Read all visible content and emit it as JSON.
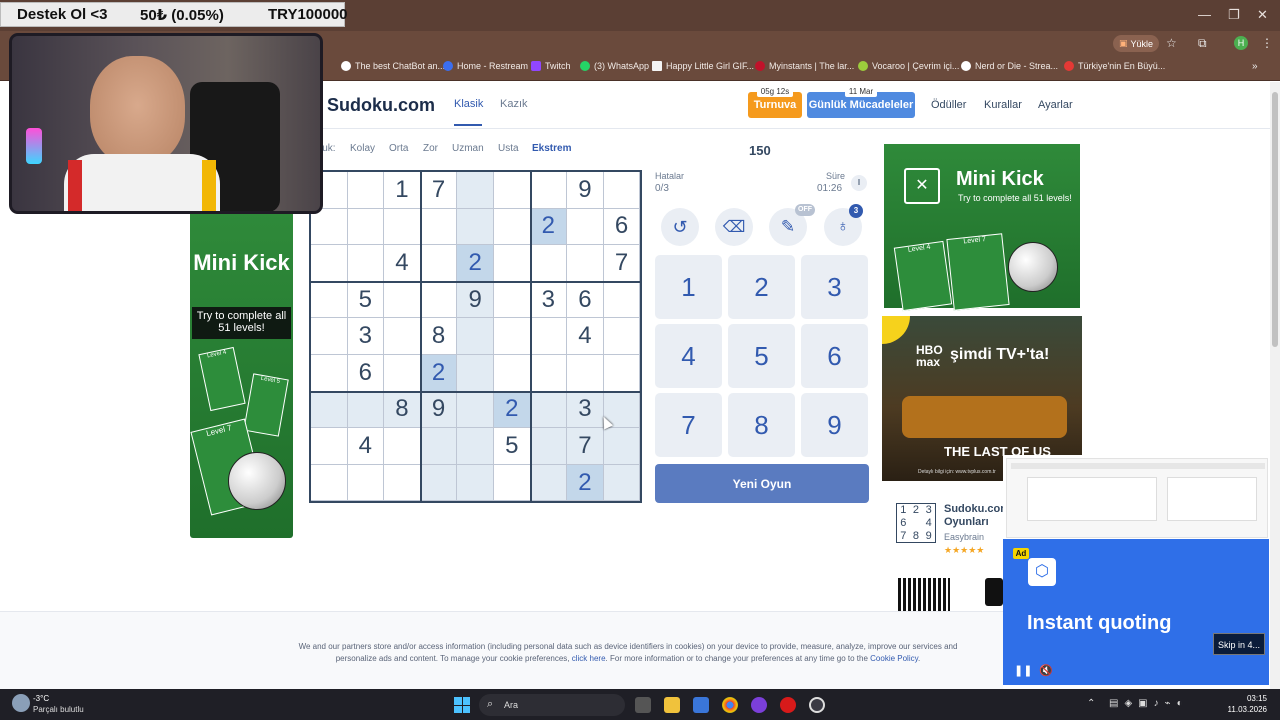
{
  "donation": {
    "left": "Destek Ol <3",
    "mid": "50₺ (0.05%)",
    "right": "TRY100000"
  },
  "browser": {
    "upload_label": "Yükle",
    "bookmarks": [
      "The best ChatBot an...",
      "Home - Restream",
      "Twitch",
      "(3) WhatsApp",
      "Happy Little Girl GIF...",
      "Myinstants | The lar...",
      "Vocaroo | Çevrim içi...",
      "Nerd or Die - Strea...",
      "Türkiye'nin En Büyü..."
    ]
  },
  "site": {
    "logo": "Sudoku.com",
    "tabs": [
      "Klasik",
      "Kazık"
    ],
    "streak_days": "05g 12s",
    "tournament": "Turnuva",
    "daily_date": "11 Mar",
    "daily": "Günlük Mücadeleler",
    "nav": [
      "Ödüller",
      "Kurallar",
      "Ayarlar"
    ],
    "difficulty_prefix": "luk:",
    "difficulties": [
      "Kolay",
      "Orta",
      "Zor",
      "Uzman",
      "Usta",
      "Ekstrem"
    ],
    "score": "150",
    "mistakes_label": "Hatalar",
    "mistakes": "0/3",
    "time_label": "Süre",
    "time": "01:26",
    "notes_badge": "OFF",
    "hint_badge": "3",
    "numpad": [
      "1",
      "2",
      "3",
      "4",
      "5",
      "6",
      "7",
      "8",
      "9"
    ],
    "new_game": "Yeni Oyun"
  },
  "grid": [
    [
      "",
      "",
      "1",
      "7",
      "",
      "",
      "",
      "9",
      ""
    ],
    [
      "",
      "",
      "",
      "",
      "",
      "",
      "2",
      "",
      "6"
    ],
    [
      "",
      "",
      "4",
      "",
      "2",
      "",
      "",
      "",
      "7"
    ],
    [
      "",
      "5",
      "",
      "",
      "9",
      "",
      "3",
      "6",
      ""
    ],
    [
      "",
      "3",
      "",
      "8",
      "",
      "",
      "",
      "4",
      ""
    ],
    [
      "",
      "6",
      "",
      "2",
      "",
      "",
      "",
      "",
      ""
    ],
    [
      "",
      "",
      "8",
      "9",
      "",
      "2",
      "",
      "3",
      ""
    ],
    [
      "",
      "4",
      "",
      "",
      "",
      "5",
      "",
      "7",
      ""
    ],
    [
      "",
      "",
      "",
      "",
      "",
      "",
      "",
      "2",
      ""
    ]
  ],
  "ads": {
    "left_title": "Mini Kick",
    "left_sub": "Try to complete all 51 levels!",
    "left_level_a": "Level 4",
    "left_level_b": "Level 5",
    "left_level_c": "Level 7",
    "right_title": "Mini Kick",
    "right_sub": "Try to complete all 51 levels!",
    "right_level_a": "Level 4",
    "right_level_b": "Level 7",
    "hbo_brand": "HBO max",
    "hbo_text": "şimdi TV+'ta!",
    "hbo_show": "THE LAST OF US",
    "hbo_fine": "Detaylı bilgi için: www.tvplus.com.tr",
    "app_name": "Sudoku.com Oyunları",
    "app_dev": "Easybrain",
    "app_icon_digits": [
      "1",
      "2",
      "3",
      "6",
      "",
      "4",
      "7",
      "8",
      "9"
    ],
    "video_badge": "Ad",
    "video_text": "Instant quoting",
    "skip": "Skip in 4..."
  },
  "cookie": {
    "line1": "We and our partners store and/or access information (including personal data such as device identifiers in cookies) on your device to provide, measure, analyze, improve our services and",
    "line2a": "personalize ads and content. To manage your cookie preferences,",
    "link1": "click here",
    "line2b": ". For more information or to change your preferences at any time go to the",
    "link2": "Cookie Policy",
    "end": "."
  },
  "taskbar": {
    "temp": "-3°C",
    "weather": "Parçalı bulutlu",
    "search": "Ara",
    "time": "03:15",
    "date": "11.03.2026"
  }
}
